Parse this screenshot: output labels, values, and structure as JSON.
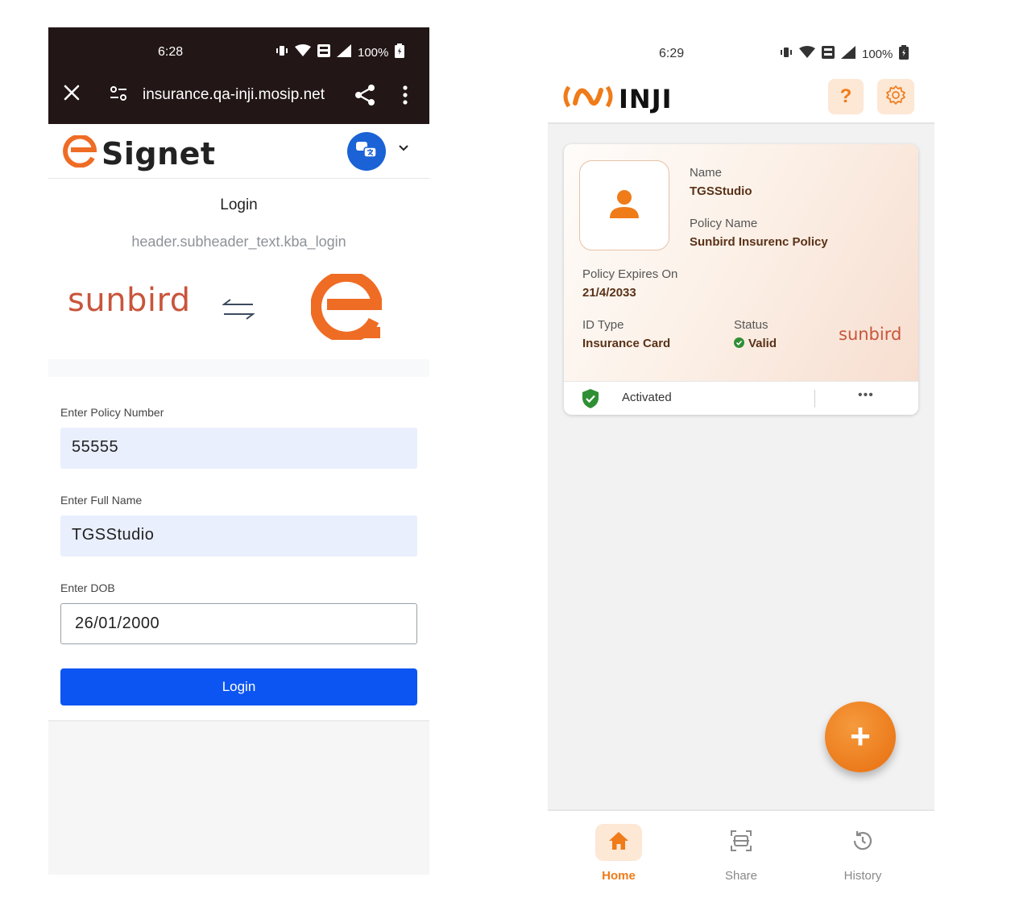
{
  "left": {
    "status_time": "6:28",
    "battery": "100%",
    "url": "insurance.qa-inji.mosip.net",
    "brand": "Signet",
    "page_title": "Login",
    "subheader": "header.subheader_text.kba_login",
    "partner": "sunbird",
    "fields": [
      {
        "label": "Enter Policy Number",
        "value": "55555"
      },
      {
        "label": "Enter Full Name",
        "value": "TGSStudio"
      },
      {
        "label": "Enter DOB",
        "value": "26/01/2000"
      }
    ],
    "login_button": "Login"
  },
  "right": {
    "status_time": "6:29",
    "battery": "100%",
    "brand": "INJI",
    "help_label": "?",
    "card": {
      "name_label": "Name",
      "name_value": "TGSStudio",
      "policy_name_label": "Policy Name",
      "policy_name_value": "Sunbird Insurenc Policy",
      "expires_label": "Policy Expires On",
      "expires_value": "21/4/2033",
      "id_type_label": "ID Type",
      "id_type_value": "Insurance Card",
      "status_label": "Status",
      "status_value": "Valid",
      "issuer_logo": "sunbird",
      "activation": "Activated",
      "more": "•••"
    },
    "fab_label": "+",
    "nav": [
      {
        "label": "Home",
        "icon": "home-icon",
        "active": true
      },
      {
        "label": "Share",
        "icon": "scan-icon",
        "active": false
      },
      {
        "label": "History",
        "icon": "history-icon",
        "active": false
      }
    ]
  },
  "colors": {
    "accent_orange": "#ef7b19",
    "signet_blue": "#0c55f2",
    "input_fill": "#e9effd",
    "status_valid": "#2f8f35",
    "sunbird_brand": "#c8553b"
  }
}
